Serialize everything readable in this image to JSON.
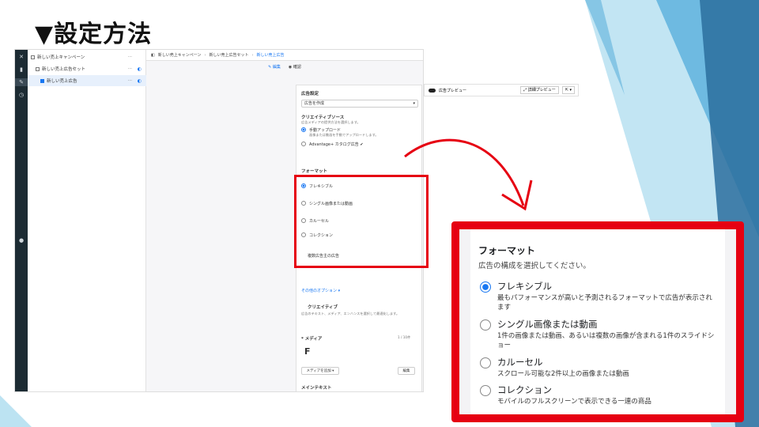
{
  "slide": {
    "title": "▼設定方法",
    "colors": {
      "accent_red": "#e60012",
      "deco_light": "#8fd0ea",
      "deco_mid": "#4aa8d8",
      "deco_dark": "#2b6f9e"
    }
  },
  "ui": {
    "rail_icons": [
      "close-icon",
      "chart-icon",
      "edit-icon",
      "clock-icon",
      "info-icon"
    ],
    "tree": [
      {
        "label": "新しい売上キャンペーン"
      },
      {
        "label": "新しい売上広告セット"
      },
      {
        "label": "新しい売上広告"
      }
    ],
    "breadcrumb": {
      "campaign": "新しい売上キャンペーン",
      "adset": "新しい売上広告セット",
      "ad": "新しい売上広告"
    },
    "modes": {
      "edit": "編集",
      "review": "確認"
    },
    "editor": {
      "ad_setup": "広告設定",
      "ad_setup_value": "広告を作成",
      "creative_source": "クリエイティブソース",
      "creative_source_sub": "広告メディアの提供方法を選択します。",
      "manual_upload": "手動アップロード",
      "manual_upload_desc": "画像または動画を手動でアップロードします。",
      "catalog": "Advantage+ カタログ広告 ✔",
      "format": "フォーマット",
      "options": [
        "フレキシブル",
        "シングル画像または動画",
        "カルーセル",
        "コレクション"
      ],
      "multi_ad": "複数広告主の広告",
      "more_options": "その他のオプション ▾",
      "creative": "クリエイティブ",
      "creative_sub": "広告のテキスト、メディア、エンハンスを選択して最適化します。",
      "media": "* メディア",
      "media_count": "1 / 10件",
      "media_letter": "F",
      "add_media": "メディアを追加 ▾",
      "edit_button": "編集",
      "primary_text": "メインテキスト"
    },
    "preview": {
      "label": "広告プレビュー",
      "detail_button": "詳細プレビュー"
    }
  },
  "callout": {
    "title": "フォーマット",
    "subtitle": "広告の構成を選択してください。",
    "options": [
      {
        "label": "フレキシブル",
        "desc": "最もパフォーマンスが高いと予測されるフォーマットで広告が表示されます",
        "selected": true
      },
      {
        "label": "シングル画像または動画",
        "desc": "1件の画像または動画、あるいは複数の画像が含まれる1件のスライドショー",
        "selected": false
      },
      {
        "label": "カルーセル",
        "desc": "スクロール可能な2件以上の画像または動画",
        "selected": false
      },
      {
        "label": "コレクション",
        "desc": "モバイルのフルスクリーンで表示できる一連の商品",
        "selected": false
      }
    ]
  }
}
